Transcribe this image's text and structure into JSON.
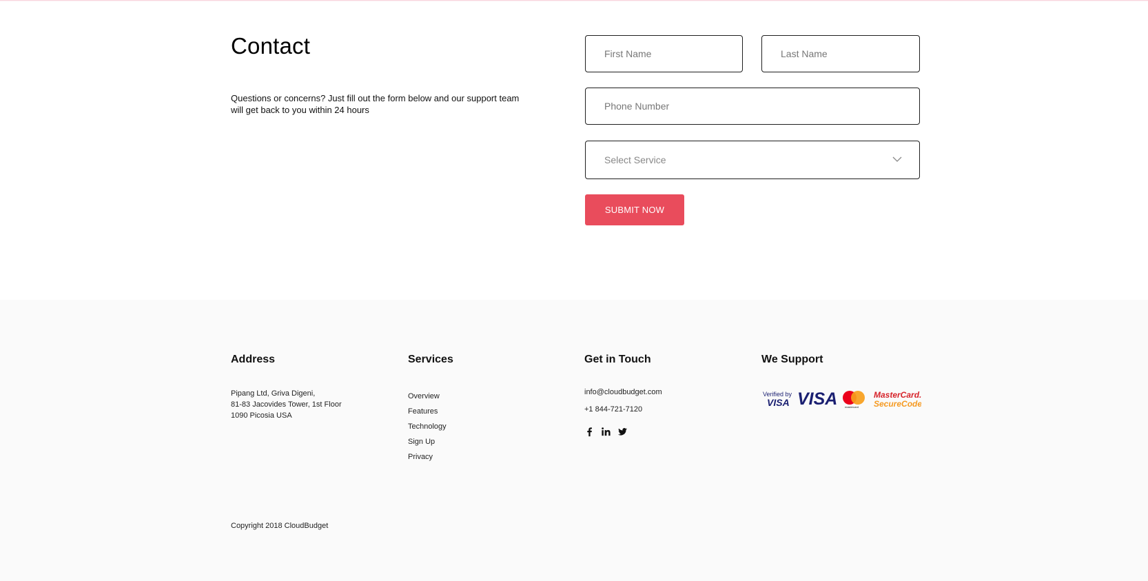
{
  "contact": {
    "title": "Contact",
    "description": "Questions or concerns? Just fill out the form below and our support team will get back to you within 24 hours"
  },
  "form": {
    "first_name_placeholder": "First Name",
    "last_name_placeholder": "Last Name",
    "phone_placeholder": "Phone Number",
    "service_placeholder": "Select Service",
    "submit_label": "SUBMIT NOW",
    "submit_color": "#e94c5c"
  },
  "footer": {
    "address": {
      "heading": "Address",
      "lines": [
        "Pipang Ltd, Griva Digeni,",
        "81-83 Jacovides Tower, 1st Floor",
        "1090 Picosia USA"
      ]
    },
    "services": {
      "heading": "Services",
      "items": [
        "Overview",
        "Features",
        "Technology",
        "Sign Up",
        "Privacy"
      ]
    },
    "get_in_touch": {
      "heading": "Get in Touch",
      "email": "info@cloudbudget.com",
      "phone": "+1 844-721-7120",
      "social_icons": [
        "facebook-icon",
        "linkedin-icon",
        "twitter-icon"
      ]
    },
    "we_support": {
      "heading": "We Support",
      "badges": {
        "verified_by": "Verified by",
        "verified_visa": "VISA",
        "visa": "VISA",
        "mastercard_small": "mastercard",
        "mastercard_securecode_1": "MasterCard.",
        "mastercard_securecode_2": "SecureCode."
      }
    },
    "copyright": "Copyright 2018 CloudBudget",
    "background": "#fafafa"
  }
}
